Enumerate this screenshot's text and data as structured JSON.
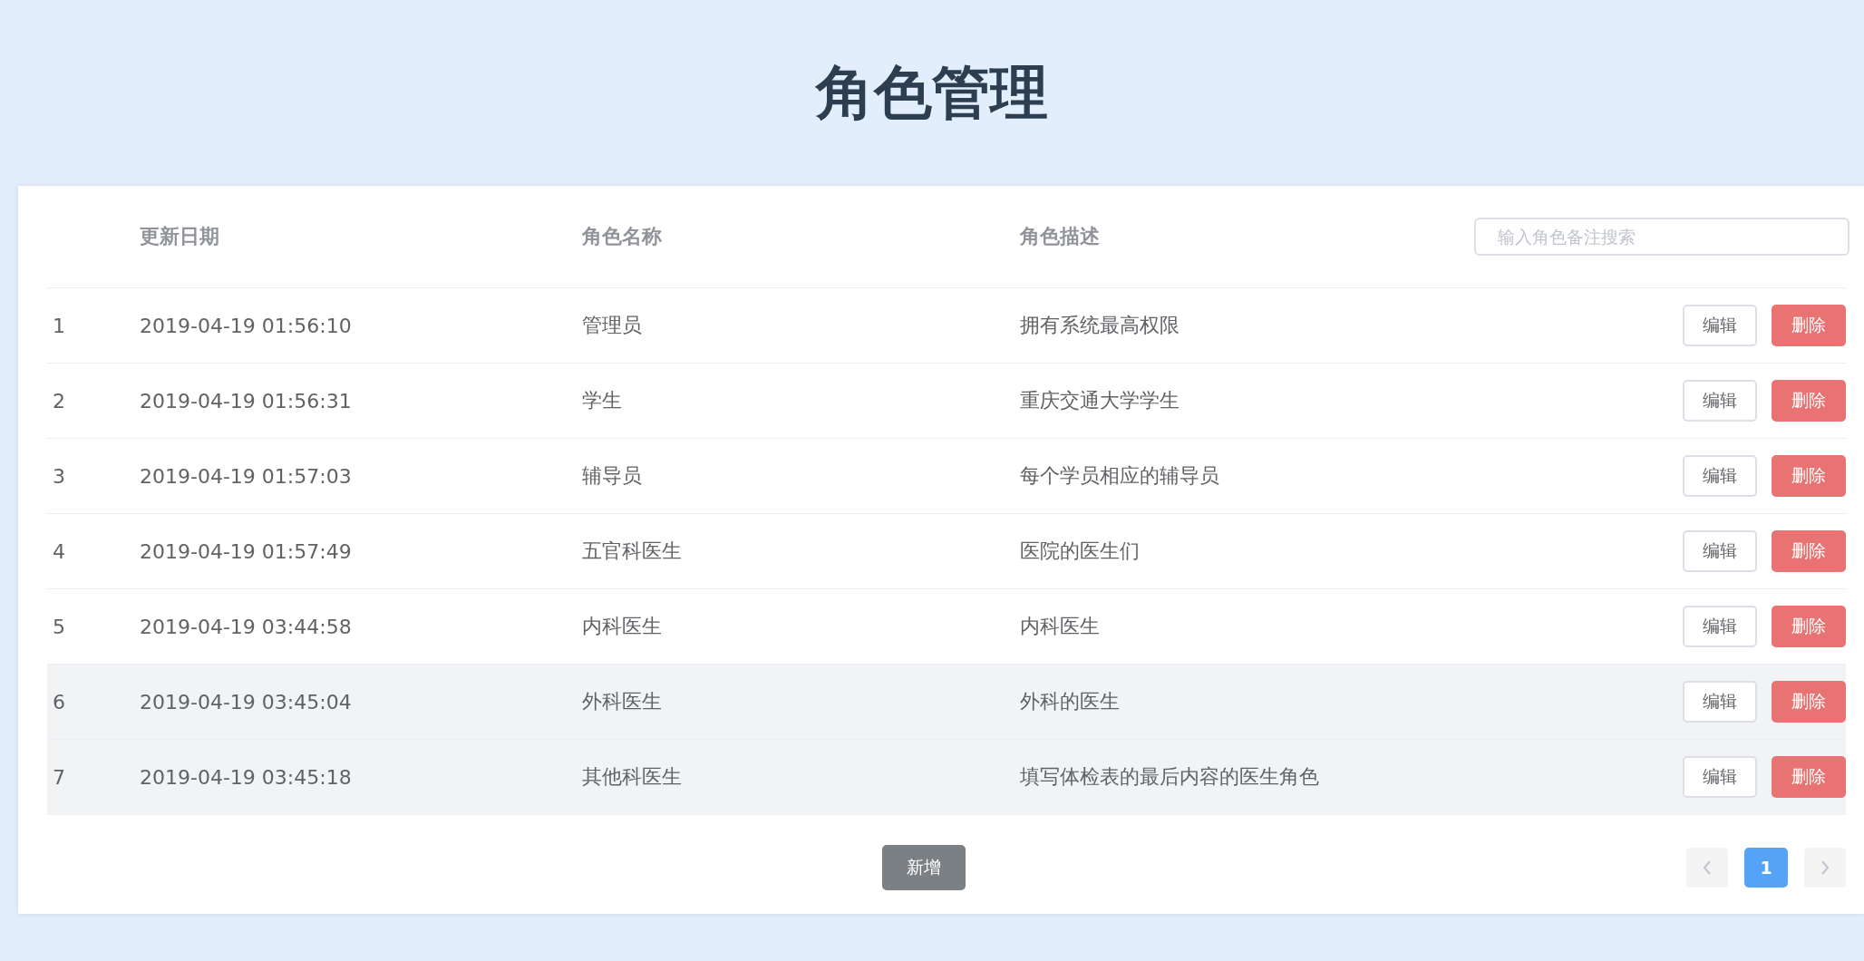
{
  "title": "角色管理",
  "table": {
    "columns": [
      "",
      "更新日期",
      "角色名称",
      "角色描述"
    ],
    "search": {
      "placeholder": "输入角色备注搜索"
    },
    "rows": [
      {
        "index": "1",
        "date": "2019-04-19 01:56:10",
        "name": "管理员",
        "description": "拥有系统最高权限",
        "shaded": false,
        "actions": [
          "编辑",
          "删除"
        ]
      },
      {
        "index": "2",
        "date": "2019-04-19 01:56:31",
        "name": "学生",
        "description": "重庆交通大学学生",
        "shaded": false,
        "actions": [
          "编辑",
          "删除"
        ]
      },
      {
        "index": "3",
        "date": "2019-04-19 01:57:03",
        "name": "辅导员",
        "description": "每个学员相应的辅导员",
        "shaded": false,
        "actions": [
          "编辑",
          "删除"
        ]
      },
      {
        "index": "4",
        "date": "2019-04-19 01:57:49",
        "name": "五官科医生",
        "description": "医院的医生们",
        "shaded": false,
        "actions": [
          "编辑",
          "删除"
        ]
      },
      {
        "index": "5",
        "date": "2019-04-19 03:44:58",
        "name": "内科医生",
        "description": "内科医生",
        "shaded": false,
        "actions": [
          "编辑",
          "删除"
        ]
      },
      {
        "index": "6",
        "date": "2019-04-19 03:45:04",
        "name": "外科医生",
        "description": "外科的医生",
        "shaded": true,
        "actions": [
          "编辑",
          "删除"
        ]
      },
      {
        "index": "7",
        "date": "2019-04-19 03:45:18",
        "name": "其他科医生",
        "description": "填写体检表的最后内容的医生角色",
        "shaded": true,
        "actions": [
          "编辑",
          "删除"
        ]
      }
    ]
  },
  "add_button": "新增",
  "pagination": {
    "pages": [
      {
        "label": "1",
        "selected": true
      }
    ]
  }
}
